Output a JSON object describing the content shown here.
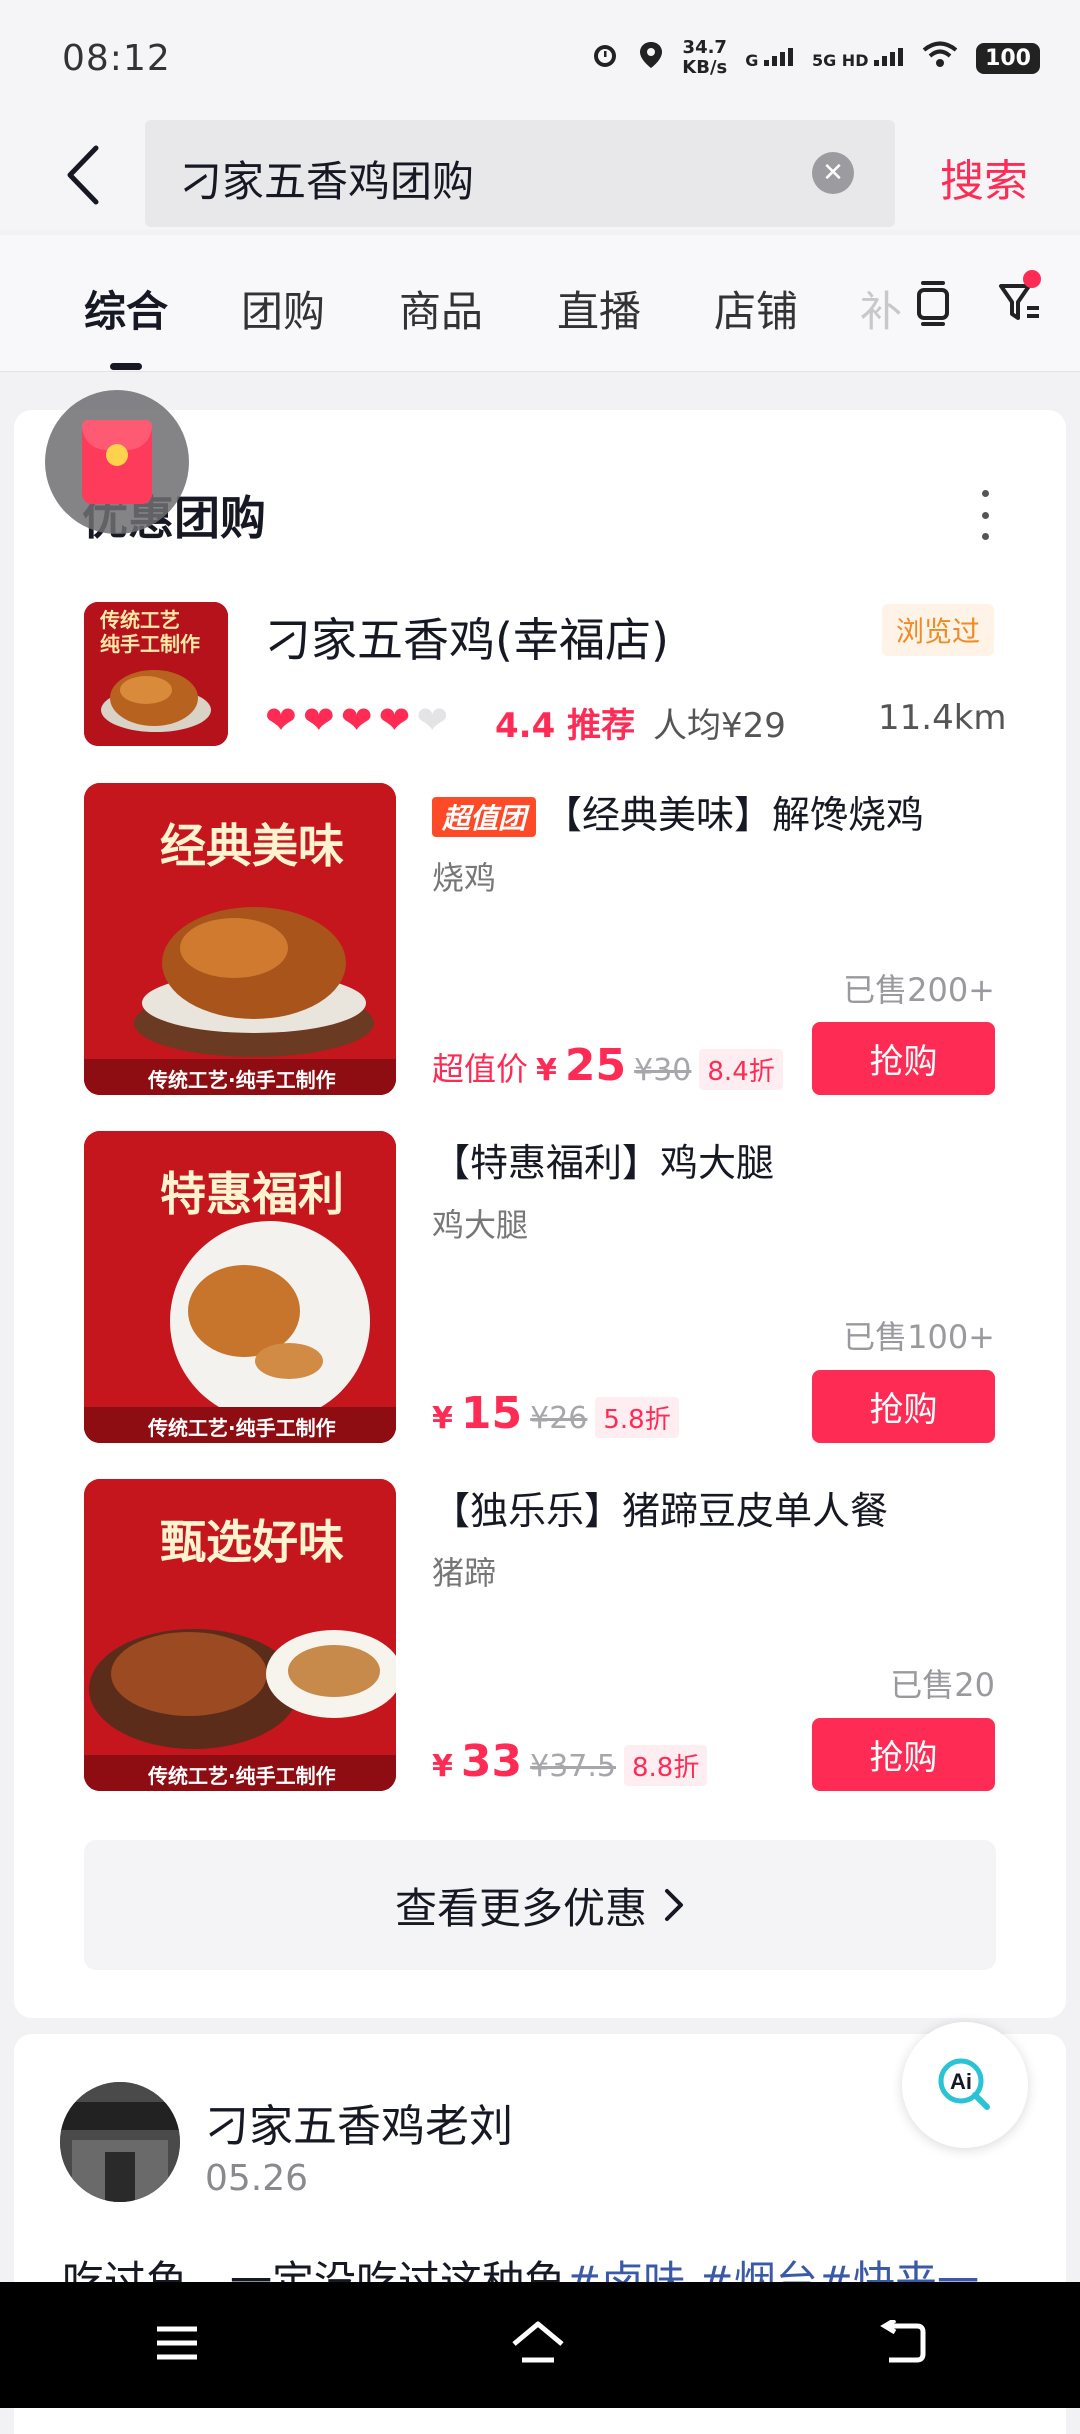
{
  "status": {
    "time": "08:12",
    "net_speed": "34.7",
    "net_unit": "KB/s",
    "sig1": "G",
    "sig2": "5G HD",
    "battery": "100"
  },
  "search": {
    "query": "刁家五香鸡团购",
    "button": "搜索"
  },
  "tabs": [
    "综合",
    "团购",
    "商品",
    "直播",
    "店铺",
    "补"
  ],
  "section": {
    "title": "优惠团购"
  },
  "shop": {
    "name": "刁家五香鸡(幸福店)",
    "visited": "浏览过",
    "rating": "4.4 推荐",
    "avg_price": "人均¥29",
    "distance": "11.4km",
    "thumb_lines": [
      "传统工艺",
      "纯手工制作"
    ]
  },
  "deals": [
    {
      "badge": "超值团",
      "title": "【经典美味】解馋烧鸡",
      "subtitle": "烧鸡",
      "sold": "已售200+",
      "price_prefix": "超值价",
      "currency": "¥",
      "price": "25",
      "orig": "¥30",
      "discount": "8.4折",
      "button": "抢购",
      "img_title": "经典美味",
      "img_footer": "传统工艺·纯手工制作"
    },
    {
      "badge": "",
      "title": "【特惠福利】鸡大腿",
      "subtitle": "鸡大腿",
      "sold": "已售100+",
      "price_prefix": "",
      "currency": "¥",
      "price": "15",
      "orig": "¥26",
      "discount": "5.8折",
      "button": "抢购",
      "img_title": "特惠福利",
      "img_footer": "传统工艺·纯手工制作"
    },
    {
      "badge": "",
      "title": "【独乐乐】猪蹄豆皮单人餐",
      "subtitle": "猪蹄",
      "sold": "已售20",
      "price_prefix": "",
      "currency": "¥",
      "price": "33",
      "orig": "¥37.5",
      "discount": "8.8折",
      "button": "抢购",
      "img_title": "甄选好味",
      "img_footer": "传统工艺·纯手工制作"
    }
  ],
  "see_more": "查看更多优惠",
  "post": {
    "author": "刁家五香鸡老刘",
    "date": "05.26",
    "text_plain": "吃过鱼，一定没吃过这种鱼",
    "tags": "#卤味 #烟台#快来一"
  },
  "colors": {
    "accent": "#fe2c55",
    "orange": "#f08a24",
    "tag_blue": "#3a5aa8"
  }
}
